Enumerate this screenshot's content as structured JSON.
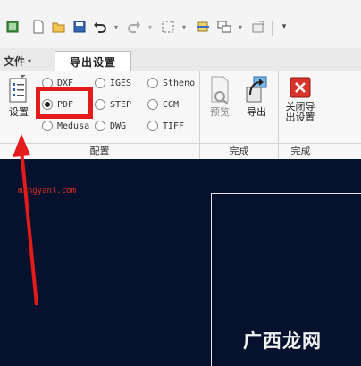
{
  "tabs": {
    "file_label": "文件",
    "active_label": "导出设置"
  },
  "ribbon": {
    "settings_label": "设置",
    "formats": [
      {
        "label": "DXF",
        "checked": false
      },
      {
        "label": "IGES",
        "checked": false
      },
      {
        "label": "Stheno",
        "checked": false
      },
      {
        "label": "PDF",
        "checked": true
      },
      {
        "label": "STEP",
        "checked": false
      },
      {
        "label": "CGM",
        "checked": false
      },
      {
        "label": "Medusa",
        "checked": false
      },
      {
        "label": "DWG",
        "checked": false
      },
      {
        "label": "TIFF",
        "checked": false
      }
    ],
    "preview_label": "预览",
    "export_label": "导出",
    "close_label_line1": "关闭导",
    "close_label_line2": "出设置",
    "groups": {
      "config": "配置",
      "finish1": "完成",
      "finish2": "完成"
    }
  },
  "canvas": {
    "watermark_url": "mingyanl.com",
    "brand": "广西龙网"
  },
  "colors": {
    "highlight": "#e31b1b",
    "canvas_bg": "#06112e"
  }
}
